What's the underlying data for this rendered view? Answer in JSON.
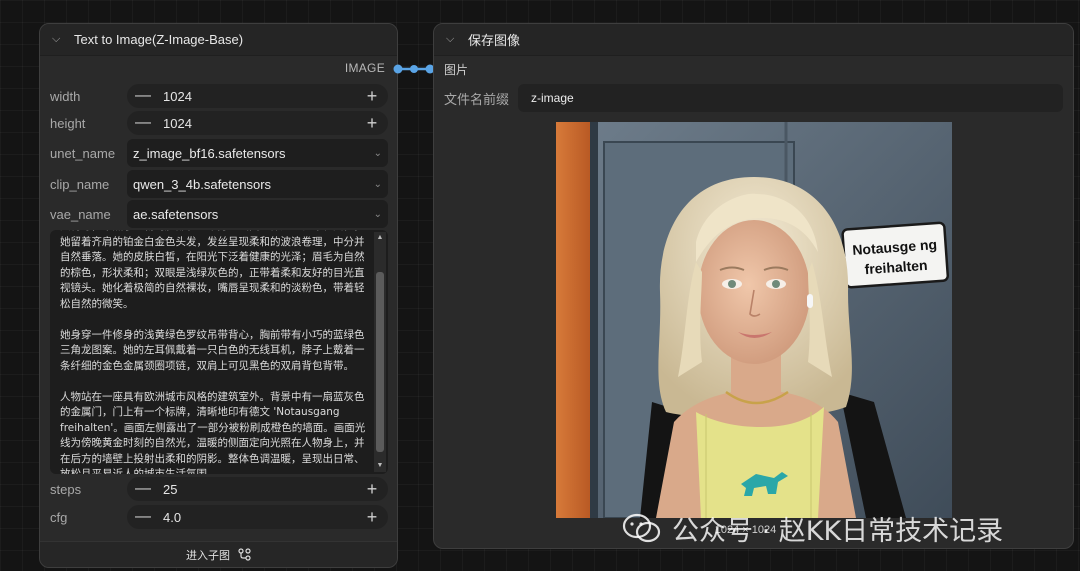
{
  "left_node": {
    "title": "Text to Image(Z-Image-Base)",
    "output_label": "IMAGE",
    "widgets": {
      "width": {
        "label": "width",
        "value": "1024"
      },
      "height": {
        "label": "height",
        "value": "1024"
      },
      "unet_name": {
        "label": "unet_name",
        "value": "z_image_bf16.safetensors"
      },
      "clip_name": {
        "label": "clip_name",
        "value": "qwen_3_4b.safetensors"
      },
      "vae_name": {
        "label": "vae_name",
        "value": "ae.safetensors"
      },
      "steps": {
        "label": "steps",
        "value": "25"
      },
      "cfg": {
        "label": "cfg",
        "value": "4.0"
      }
    },
    "prompt_text": "大特写，聚焦于人物的脸部和上半身。画面主体是一位年轻女性，她留着齐肩的铂金白金色头发，发丝呈现柔和的波浪卷理，中分并自然垂落。她的皮肤白皙，在阳光下泛着健康的光泽；眉毛为自然的棕色，形状柔和；双眼是浅绿灰色的，正带着柔和友好的目光直视镜头。她化着极简的自然裸妆，嘴唇呈现柔和的淡粉色，带着轻松自然的微笑。\n\n她身穿一件修身的浅黄绿色罗纹吊带背心，胸前带有小巧的蓝绿色三角龙图案。她的左耳佩戴着一只白色的无线耳机，脖子上戴着一条纤细的金色金属颈圈项链，双肩上可见黑色的双肩背包背带。\n\n人物站在一座具有欧洲城市风格的建筑室外。背景中有一扇蓝灰色的金属门，门上有一个标牌，清晰地印有德文 'Notausgang freihalten'。画面左侧露出了一部分被粉刷成橙色的墙面。画面光线为傍晚黄金时刻的自然光，温暖的侧面定向光照在人物身上，并在后方的墙壁上投射出柔和的阴影。整体色调温暖，呈现出日常、放松且平易近人的城市生活氛围。",
    "footer_label": "进入子图"
  },
  "right_node": {
    "title": "保存图像",
    "input_label": "图片",
    "prefix_label": "文件名前缀",
    "prefix_value": "z-image",
    "image_caption": "1024 × 1024",
    "sign_line1": "Notausge ng",
    "sign_line2": "freihalten"
  },
  "watermark": {
    "text": "公众号 · 赵KK日常技术记录"
  },
  "colors": {
    "link_blue": "#5aa4e6",
    "canvas_bg": "#141414",
    "node_bg": "#2a2a2a",
    "tank_top": "#e4e28a",
    "dino": "#2aa7a8"
  },
  "icons": {
    "collapse": "chevron-down-icon",
    "minus": "minus-icon",
    "plus": "plus-icon",
    "dropdown": "dropdown-arrow-icon",
    "subgraph": "subgraph-icon"
  }
}
